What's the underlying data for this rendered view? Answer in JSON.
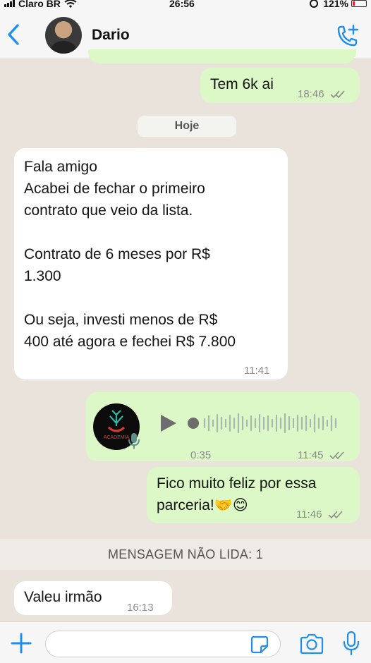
{
  "status": {
    "carrier": "Claro BR",
    "time": "26:56",
    "battery": "121%"
  },
  "header": {
    "contact_name": "Dario"
  },
  "chat": {
    "messages": [
      {
        "text": "Tem 6k ai",
        "time": "18:46"
      },
      {
        "date_chip": "Hoje"
      },
      {
        "lines": [
          "Fala amigo",
          "Acabei de fechar o primeiro",
          "contrato que veio da lista.",
          "",
          "Contrato de 6 meses por R$",
          "1.300",
          "",
          "Ou seja, investi menos de R$",
          "400 até agora e fechei R$ 7.800"
        ],
        "time": "11:41"
      },
      {
        "audio_duration": "0:35",
        "avatar_text": "ACADEMIA",
        "time": "11:45"
      },
      {
        "lines": [
          "Fico muito feliz por essa",
          "parceria!🤝😊"
        ],
        "time": "11:46"
      },
      {
        "unread_banner": "MENSAGEM NÃO LIDA: 1"
      },
      {
        "text": "Valeu irmão",
        "time": "16:13"
      }
    ]
  },
  "input": {
    "placeholder": ""
  },
  "colors": {
    "accent": "#1f8ef1",
    "outgoing_bubble": "#dcf8c6",
    "incoming_bubble": "#ffffff",
    "chat_background": "#e9e3dc",
    "read_ticks": "#8c8c8c"
  }
}
